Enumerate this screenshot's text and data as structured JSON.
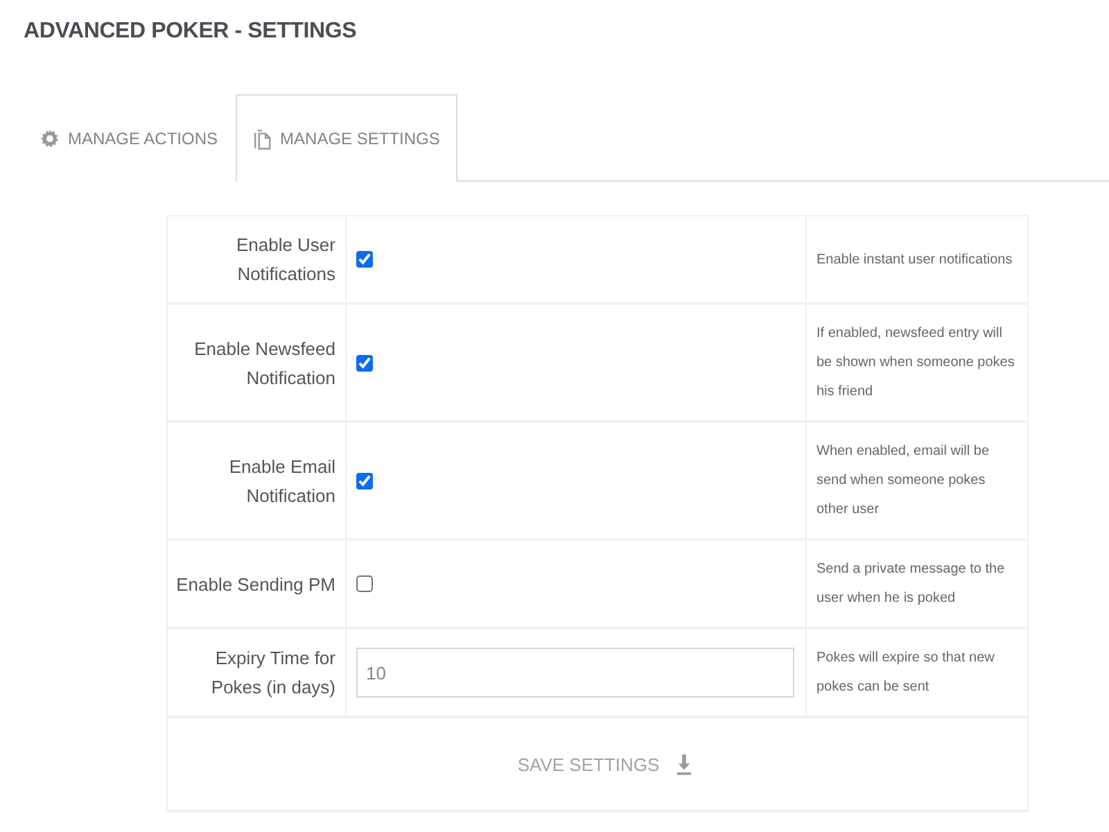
{
  "page": {
    "title": "ADVANCED POKER - SETTINGS"
  },
  "tabs": [
    {
      "label": "MANAGE ACTIONS",
      "selected": false
    },
    {
      "label": "MANAGE SETTINGS",
      "selected": true
    }
  ],
  "settings": [
    {
      "kind": "checkbox",
      "label": "Enable User Notifications",
      "checked": true,
      "description": "Enable instant user notifications"
    },
    {
      "kind": "checkbox",
      "label": "Enable Newsfeed Notification",
      "checked": true,
      "description": "If enabled, newsfeed entry will be shown when someone pokes his friend"
    },
    {
      "kind": "checkbox",
      "label": "Enable Email Notification",
      "checked": true,
      "description": "When enabled, email will be send when someone pokes other user"
    },
    {
      "kind": "checkbox",
      "label": "Enable Sending PM",
      "checked": false,
      "description": "Send a private message to the user when he is poked"
    },
    {
      "kind": "text",
      "label": "Expiry Time for Pokes (in days)",
      "value": "10",
      "description": "Pokes will expire so that new pokes can be sent"
    }
  ],
  "save_button": {
    "label": "SAVE SETTINGS"
  }
}
